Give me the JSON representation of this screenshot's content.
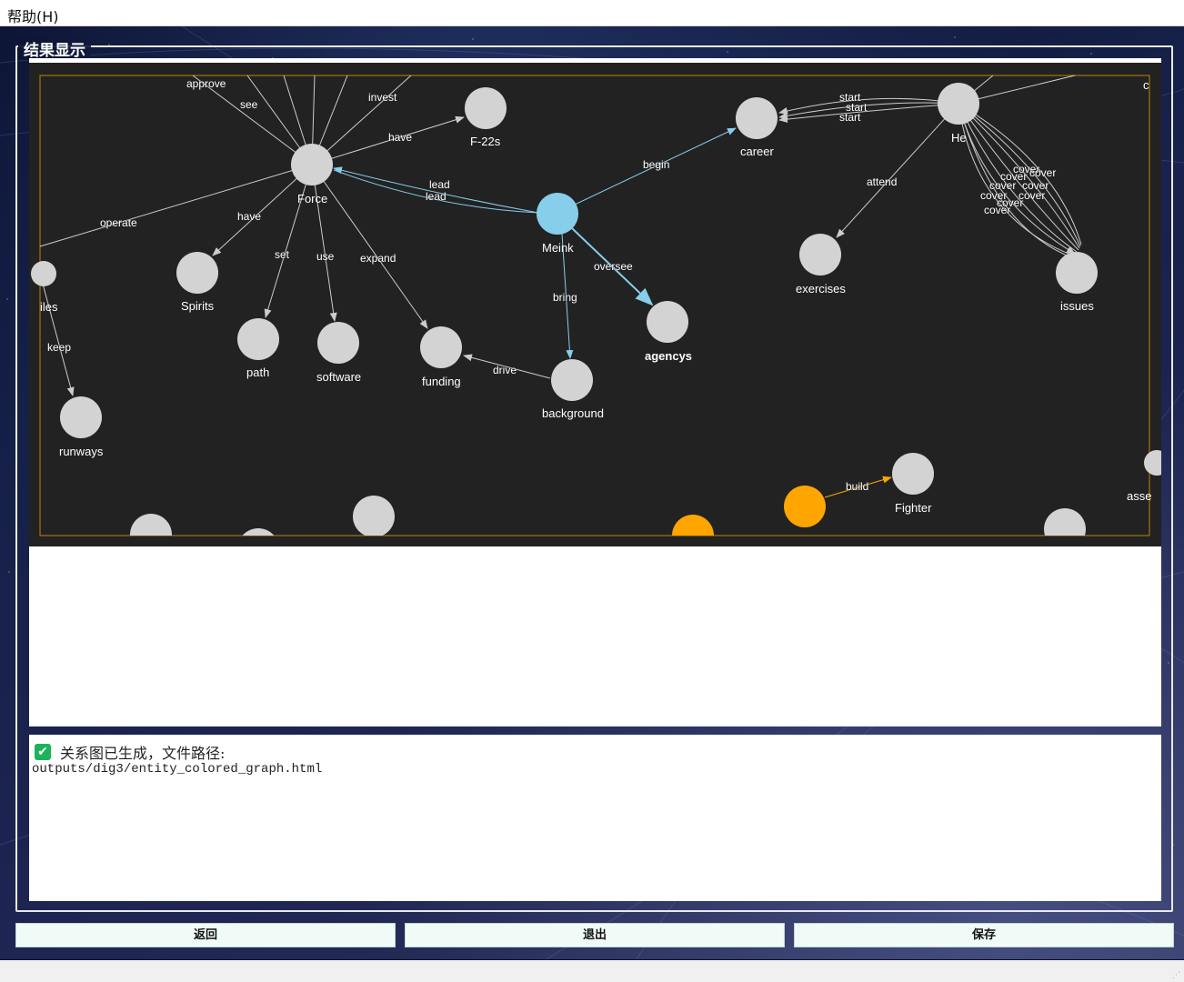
{
  "menu": {
    "help_label": "帮助(H)"
  },
  "group": {
    "title": "结果显示"
  },
  "graph": {
    "node_labels": {
      "force": "Force",
      "meink": "Meink",
      "f22s": "F-22s",
      "career": "career",
      "he": "He",
      "exercises": "exercises",
      "issues": "issues",
      "spirits": "Spirits",
      "path": "path",
      "software": "software",
      "funding": "funding",
      "background": "background",
      "agencys": "agencys",
      "runways": "runways",
      "fighter": "Fighter",
      "iles": "iles",
      "asse": "asse",
      "c": "c"
    },
    "edge_labels": {
      "approve": "approve",
      "see": "see",
      "invest": "invest",
      "have1": "have",
      "have2": "have",
      "lead1": "lead",
      "lead2": "lead",
      "begin": "begin",
      "start1": "start",
      "start2": "start",
      "start3": "start",
      "attend": "attend",
      "operate": "operate",
      "set": "set",
      "use": "use",
      "expand": "expand",
      "oversee": "oversee",
      "bring": "bring",
      "drive": "drive",
      "keep": "keep",
      "build": "build",
      "cover": "cover"
    },
    "colors": {
      "canvas": "#222222",
      "node_default": "#d3d3d3",
      "node_selected": "#87ceeb",
      "node_highlight": "#ffa500",
      "edge": "#cccccc",
      "edge_selected": "#87ceeb",
      "frame": "#b8860b"
    }
  },
  "log": {
    "message": "关系图已生成，文件路径:",
    "path": "outputs/dig3/entity_colored_graph.html"
  },
  "buttons": {
    "back": "返回",
    "exit": "退出",
    "save": "保存"
  }
}
